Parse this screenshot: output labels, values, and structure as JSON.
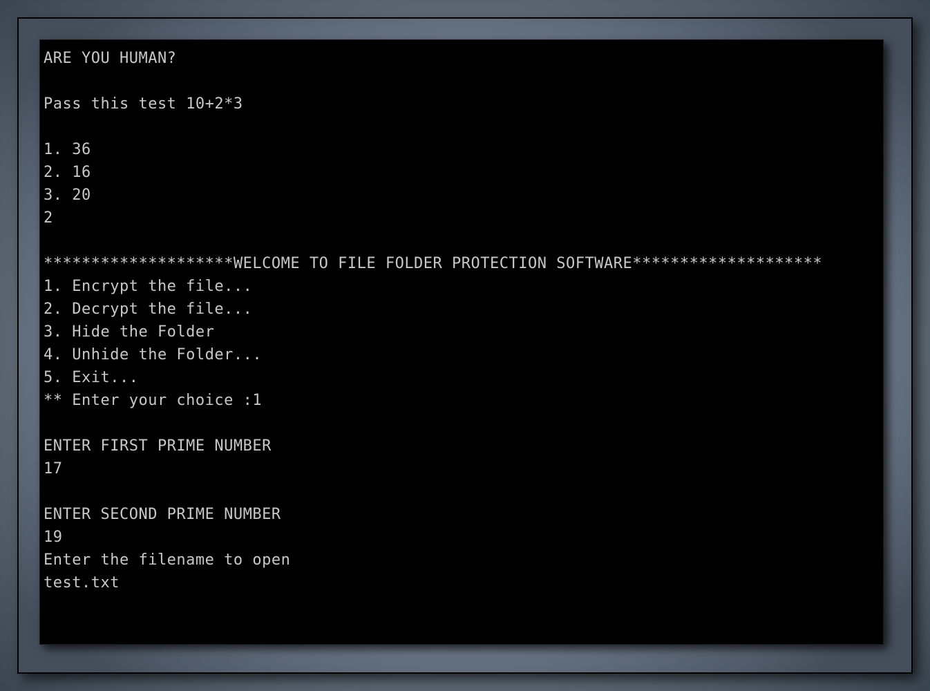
{
  "terminal": {
    "captcha_header": "ARE YOU HUMAN?",
    "captcha_question": "Pass this test 10+2*3",
    "option1": "1. 36",
    "option2": "2. 16",
    "option3": "3. 20",
    "captcha_answer": "2",
    "welcome_banner": "********************WELCOME TO FILE FOLDER PROTECTION SOFTWARE********************",
    "menu1": "1. Encrypt the file...",
    "menu2": "2. Decrypt the file...",
    "menu3": "3. Hide the Folder",
    "menu4": "4. Unhide the Folder...",
    "menu5": "5. Exit...",
    "choice_prompt": "** Enter your choice :1",
    "prime1_prompt": "ENTER FIRST PRIME NUMBER",
    "prime1_value": "17",
    "prime2_prompt": "ENTER SECOND PRIME NUMBER",
    "prime2_value": "19",
    "filename_prompt": "Enter the filename to open",
    "filename_value": "test.txt"
  }
}
